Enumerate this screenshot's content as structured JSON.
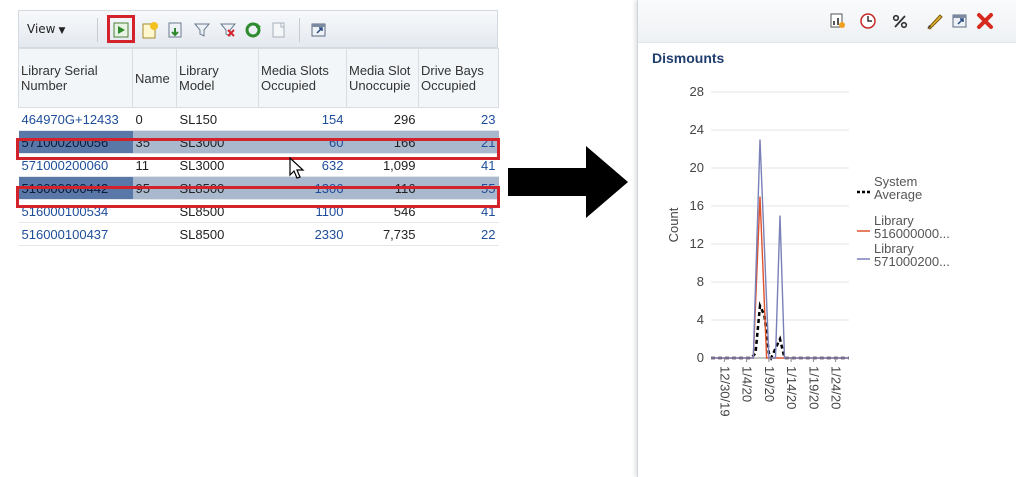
{
  "toolbar": {
    "view_label": "View",
    "icons": [
      "run-icon",
      "new-report-icon",
      "export-icon",
      "filter-icon",
      "clear-filter-icon",
      "refresh-icon",
      "document-icon",
      "detach-icon"
    ]
  },
  "table": {
    "columns": [
      "Library Serial Number",
      "Name",
      "Library Model",
      "Media Slots Occupied",
      "Media Slot Unoccupie",
      "Drive Bays Occupied"
    ],
    "rows": [
      {
        "serial": "464970G+12433",
        "name": "0",
        "model": "SL150",
        "occupied": "154",
        "unoccupied": "296",
        "bays": "23",
        "selected": false
      },
      {
        "serial": "571000200056",
        "name": "35",
        "model": "SL3000",
        "occupied": "60",
        "unoccupied": "166",
        "bays": "21",
        "selected": true
      },
      {
        "serial": "571000200060",
        "name": "11",
        "model": "SL3000",
        "occupied": "632",
        "unoccupied": "1,099",
        "bays": "41",
        "selected": false
      },
      {
        "serial": "516000000442",
        "name": "95",
        "model": "SL8500",
        "occupied": "1306",
        "unoccupied": "116",
        "bays": "55",
        "selected": true
      },
      {
        "serial": "516000100534",
        "name": "",
        "model": "SL8500",
        "occupied": "1100",
        "unoccupied": "546",
        "bays": "41",
        "selected": false
      },
      {
        "serial": "516000100437",
        "name": "",
        "model": "SL8500",
        "occupied": "2330",
        "unoccupied": "7,735",
        "bays": "22",
        "selected": false
      }
    ]
  },
  "panel": {
    "icons": [
      "chart-type-icon",
      "clock-icon",
      "percent-icon",
      "edit-icon",
      "detach-icon",
      "close-icon"
    ],
    "title": "Dismounts"
  },
  "chart_data": {
    "type": "line",
    "title": "Dismounts",
    "ylabel": "Count",
    "xlabel": "",
    "ylim": [
      0,
      28
    ],
    "yticks": [
      0,
      4,
      8,
      12,
      16,
      20,
      24,
      28
    ],
    "x": [
      "12/30/19",
      "1/4/20",
      "1/9/20",
      "1/14/20",
      "1/19/20",
      "1/24/20"
    ],
    "x_days": [
      0,
      5,
      10,
      15,
      20,
      25
    ],
    "xlim": [
      -3,
      28
    ],
    "grid": true,
    "legend_position": "right",
    "series": [
      {
        "name": "System Average",
        "style": "dashed",
        "color": "#000000",
        "points": [
          [
            -3,
            0
          ],
          [
            6,
            0
          ],
          [
            7,
            0.5
          ],
          [
            8,
            5.5
          ],
          [
            9,
            4.5
          ],
          [
            10,
            0.5
          ],
          [
            10.5,
            0
          ],
          [
            11.5,
            1
          ],
          [
            12.5,
            2
          ],
          [
            13.5,
            0
          ],
          [
            28,
            0
          ]
        ]
      },
      {
        "name": "Library 516000000...",
        "style": "solid",
        "color": "#e0522a",
        "points": [
          [
            -3,
            0
          ],
          [
            6.5,
            0
          ],
          [
            8,
            17
          ],
          [
            9.5,
            0
          ],
          [
            28,
            0
          ]
        ]
      },
      {
        "name": "Library 571000200...",
        "style": "solid",
        "color": "#7a80b8",
        "points": [
          [
            -3,
            0
          ],
          [
            6.5,
            0
          ],
          [
            8,
            23
          ],
          [
            10,
            0
          ],
          [
            11.5,
            0
          ],
          [
            12.5,
            15
          ],
          [
            13.5,
            0
          ],
          [
            28,
            0
          ]
        ]
      }
    ]
  }
}
